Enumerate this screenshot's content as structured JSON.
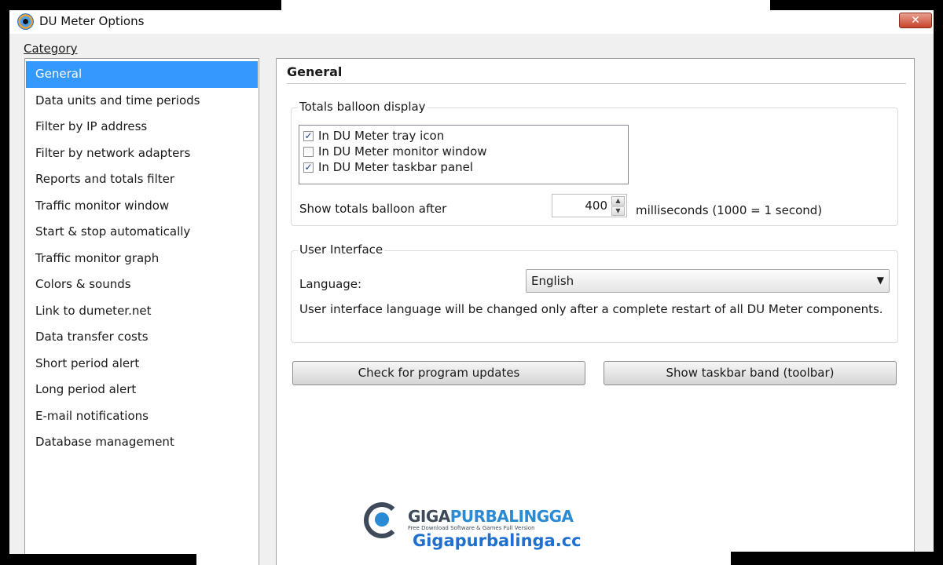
{
  "window": {
    "title": "DU Meter Options",
    "close_label": "✕"
  },
  "sidebar": {
    "heading": "Category",
    "items": [
      "General",
      "Data units and time periods",
      "Filter by IP address",
      "Filter by network adapters",
      "Reports and totals filter",
      "Traffic monitor window",
      "Start & stop automatically",
      "Traffic monitor graph",
      "Colors & sounds",
      "Link to dumeter.net",
      "Data transfer costs",
      "Short period alert",
      "Long period alert",
      "E-mail notifications",
      "Database management"
    ],
    "selected": "General"
  },
  "panel": {
    "title": "General",
    "balloon_group": {
      "legend": "Totals balloon display",
      "options": [
        {
          "label": "In DU Meter tray icon",
          "checked": true
        },
        {
          "label": "In DU Meter monitor window",
          "checked": false
        },
        {
          "label": "In DU Meter taskbar panel",
          "checked": true
        }
      ],
      "delay_label": "Show totals balloon after",
      "delay_value": "400",
      "delay_unit": "milliseconds (1000 = 1 second)"
    },
    "ui_group": {
      "legend": "User Interface",
      "language_label": "Language:",
      "language_value": "English",
      "note": "User interface language will be changed only after a complete restart of all DU Meter components."
    },
    "buttons": {
      "updates": "Check for program updates",
      "taskbar": "Show taskbar band (toolbar)"
    }
  },
  "watermark": {
    "brand_part1": "GIGA",
    "brand_part2": "PURBALINGGA",
    "tagline": "Free Download Software & Games Full Version",
    "url": "Gigapurbalinga.cc"
  },
  "icons": {
    "app": "du-meter-logo-icon",
    "checkmark": "✓",
    "spin_up": "▲",
    "spin_down": "▼",
    "dropdown": "▼"
  },
  "colors": {
    "selection": "#3399ff",
    "close_button": "#c7442c",
    "watermark_blue": "#1e6fd0"
  }
}
